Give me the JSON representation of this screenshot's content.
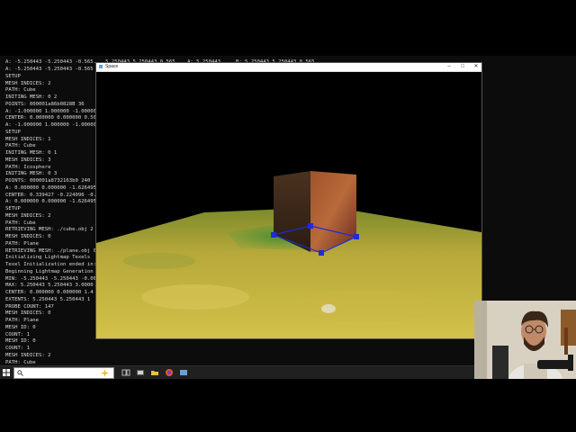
{
  "console": {
    "overflow_line": "A: -5.250443 -5.250443 -0.565... 5.250443 5.250443 0.565... A: 5.250443 ... B: 5.250443 5.250443 0.565...",
    "lines": [
      "A: -5.250443 -5.250443 -0.565",
      "SETUP",
      "MESH INDICES: 2",
      "PATH: Cube",
      "INITING MESH: 0 2",
      "POINTS: 000001a86b0828B 36",
      "A: -1.000000 1.000000 -1.00000",
      "CENTER: 0.000000 0.000000 0.50",
      "A: -1.000000 1.000000 -1.00000",
      "SETUP",
      "MESH INDICES: 1",
      "PATH: Cube",
      "INITING MESH: 0 1",
      "MESH INDICES: 3",
      "PATH: Icosphere",
      "INITING MESH: 0 3",
      "POINTS: 000001a8732163b0 240",
      "A: 0.000000 0.000000 -1.626495",
      "CENTER: 0.339427 -0.224096 -0.",
      "A: 0.000000 0.000000 -1.626495",
      "SETUP",
      "MESH INDICES: 2",
      "PATH: Cube",
      "RETRIEVING MESH: ./cube.obj 2",
      "MESH INDICES: 0",
      "PATH: Plane",
      "RETRIEVING MESH: ./plane.obj 0",
      "Initializing Lightmap Texels",
      "Texel Initialization ended in:",
      "Beginning Lightmap Generation",
      "MIN: -5.250443 -5.250443 -0.00",
      "MAX: 5.250443 5.250443 3.0000",
      "CENTER: 0.000000 0.000000 1.4",
      "EXTENTS: 5.250443 5.250443 1",
      "PROBE COUNT: 147",
      "MESH INDICES: 0",
      "PATH: Plane",
      "MESH ID: 0",
      "COUNT: 1",
      "MESH ID: 0",
      "COUNT: 1",
      "MESH INDICES: 2",
      "PATH: Cube",
      "MESH ID: 2",
      "COUNT: 1",
      "MESH ID: 0",
      "COUNT: 1",
      "MESH ID: 2",
      "COUNT: 1"
    ]
  },
  "app_window": {
    "title": "Space",
    "minimize_glyph": "–",
    "maximize_glyph": "□",
    "close_glyph": "✕"
  },
  "taskbar": {
    "search_placeholder": "Type here to search",
    "icons": [
      "windows-start-icon",
      "search-icon",
      "task-view-icon",
      "file-explorer-icon",
      "terminal-icon",
      "folder-icon",
      "firefox-icon",
      "app-icon"
    ]
  },
  "colors": {
    "console_bg": "#0c0c0c",
    "console_text": "#d8d8d8",
    "ground": "#c8b830",
    "taskbar": "#202020",
    "gizmo": "#1d2bd8"
  }
}
